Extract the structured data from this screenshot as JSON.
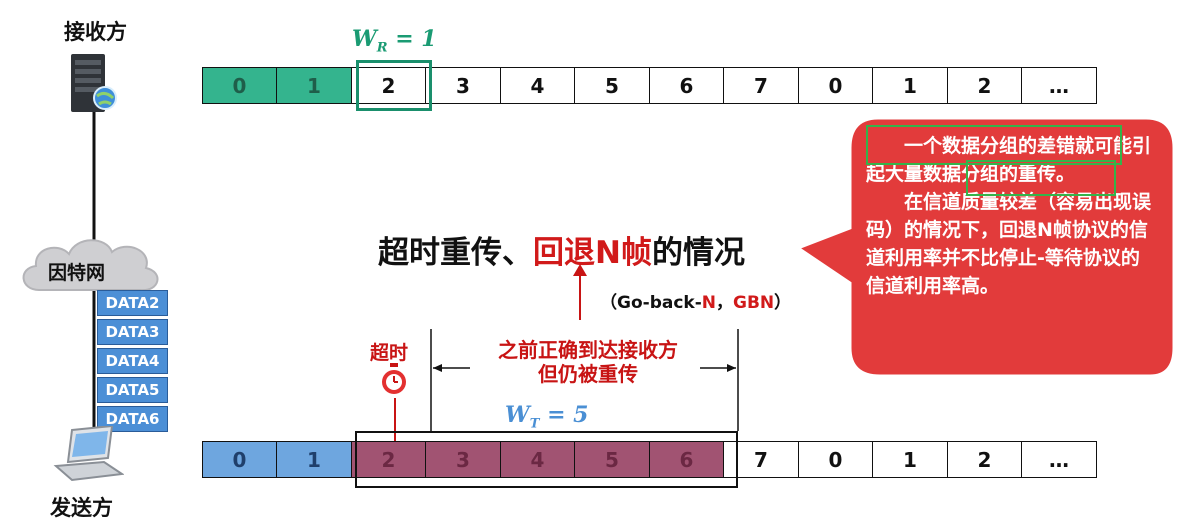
{
  "receiver_label": "接收方",
  "internet_label": "因特网",
  "sender_label": "发送方",
  "receiver_window": {
    "label": "W",
    "sub": "R",
    "eq": " = 1"
  },
  "sender_window": {
    "label": "W",
    "sub": "T",
    "eq": " = 5"
  },
  "receiver_seq": [
    {
      "label": "0",
      "state": "teal"
    },
    {
      "label": "1",
      "state": "teal"
    },
    {
      "label": "2",
      "state": "plain"
    },
    {
      "label": "3",
      "state": "plain"
    },
    {
      "label": "4",
      "state": "plain"
    },
    {
      "label": "5",
      "state": "plain"
    },
    {
      "label": "6",
      "state": "plain"
    },
    {
      "label": "7",
      "state": "plain"
    },
    {
      "label": "0",
      "state": "plain"
    },
    {
      "label": "1",
      "state": "plain"
    },
    {
      "label": "2",
      "state": "plain"
    },
    {
      "label": "…",
      "state": "plain"
    }
  ],
  "sender_seq": [
    {
      "label": "0",
      "state": "blue"
    },
    {
      "label": "1",
      "state": "blue"
    },
    {
      "label": "2",
      "state": "red"
    },
    {
      "label": "3",
      "state": "red"
    },
    {
      "label": "4",
      "state": "red"
    },
    {
      "label": "5",
      "state": "red"
    },
    {
      "label": "6",
      "state": "red"
    },
    {
      "label": "7",
      "state": "plain"
    },
    {
      "label": "0",
      "state": "plain"
    },
    {
      "label": "1",
      "state": "plain"
    },
    {
      "label": "2",
      "state": "plain"
    },
    {
      "label": "…",
      "state": "plain"
    }
  ],
  "packets": [
    "DATA2",
    "DATA3",
    "DATA4",
    "DATA5",
    "DATA6"
  ],
  "title": {
    "part1": "超时重传、",
    "part2": "回退N帧",
    "part3": "的情况"
  },
  "gbn": {
    "open": "（",
    "part1": "Go-back-",
    "part2": "N",
    "part3": "，",
    "part4": "GBN",
    "close": "）"
  },
  "timeout_label": "超时",
  "span_note": {
    "line1": "之前正确到达接收方",
    "line2": "但仍被重传"
  },
  "bubble": {
    "para1": "一个数据分组的差错就可能引起大量数据分组的重传。",
    "para2": "在信道质量较差（容易出现误码）的情况下，回退N帧协议的信道利用率并不比停止-等待协议的信道利用率高。"
  },
  "colors": {
    "teal": "#34b48e",
    "blue": "#6ea6df",
    "red": "#a15372",
    "bubble": "#e23b3b",
    "accent_red": "#d11a1a"
  }
}
